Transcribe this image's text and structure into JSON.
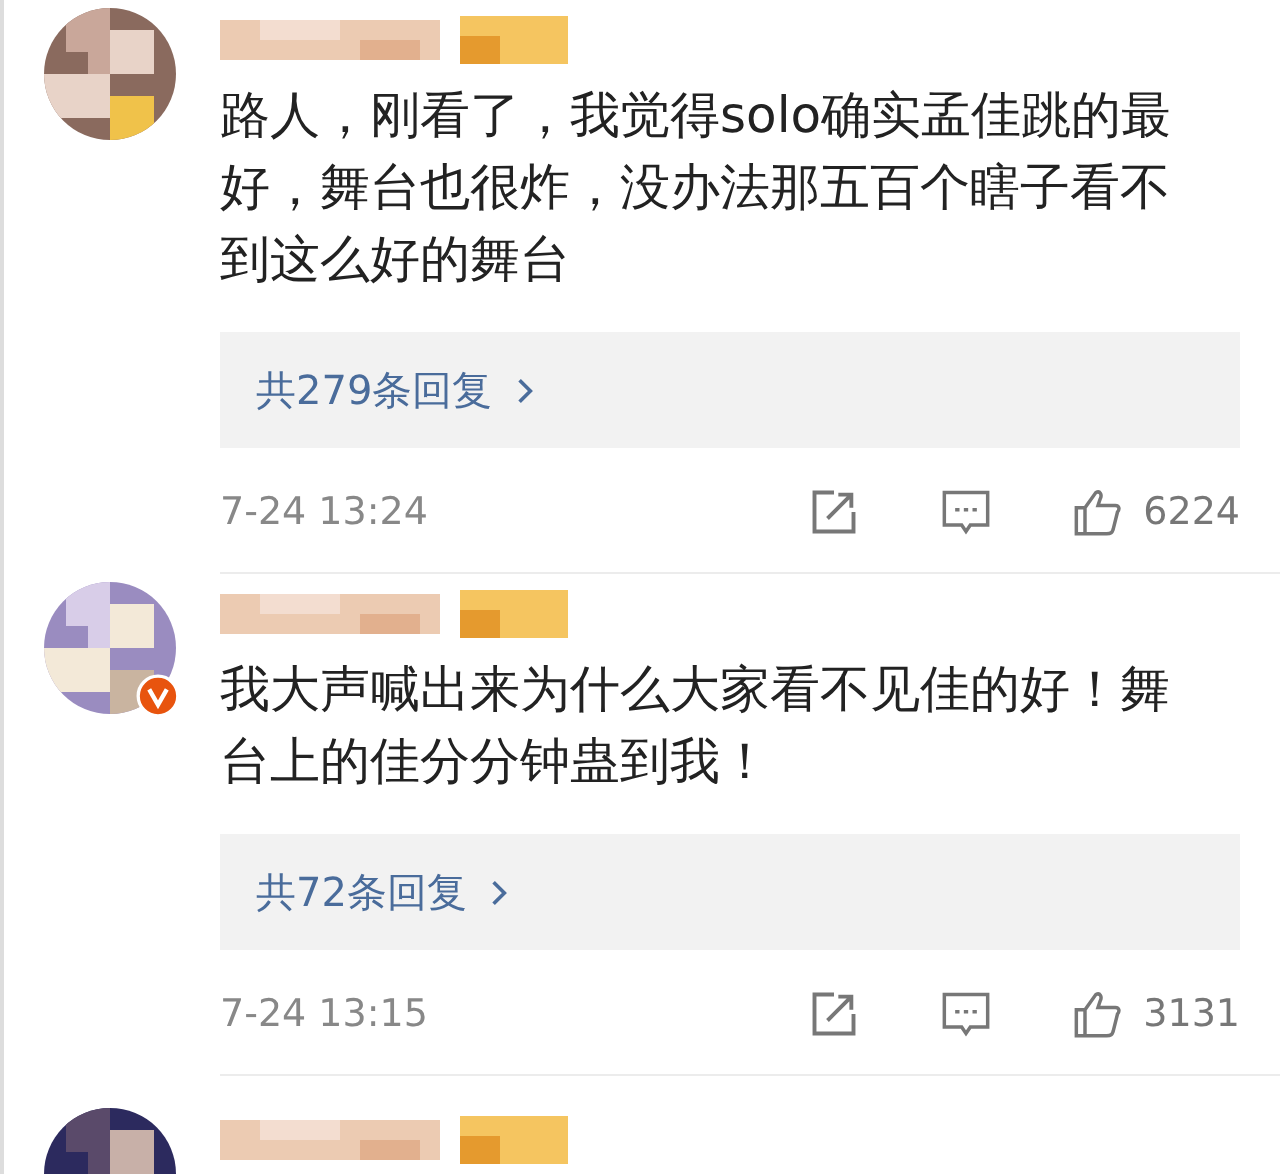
{
  "comments": [
    {
      "avatar": {
        "kind": "picture",
        "verified": false
      },
      "text": "路人，刚看了，我觉得solo确实孟佳跳的最好，舞台也很炸，没办法那五百个瞎子看不到这么好的舞台",
      "replies": "共279条回复",
      "time": "7-24 13:24",
      "likes": "6224"
    },
    {
      "avatar": {
        "kind": "picture",
        "verified": true
      },
      "text": "我大声喊出来为什么大家看不见佳的好！舞台上的佳分分钟蛊到我！",
      "replies": "共72条回复",
      "time": "7-24 13:15",
      "likes": "3131"
    },
    {
      "avatar": {
        "kind": "picture"
      }
    }
  ]
}
